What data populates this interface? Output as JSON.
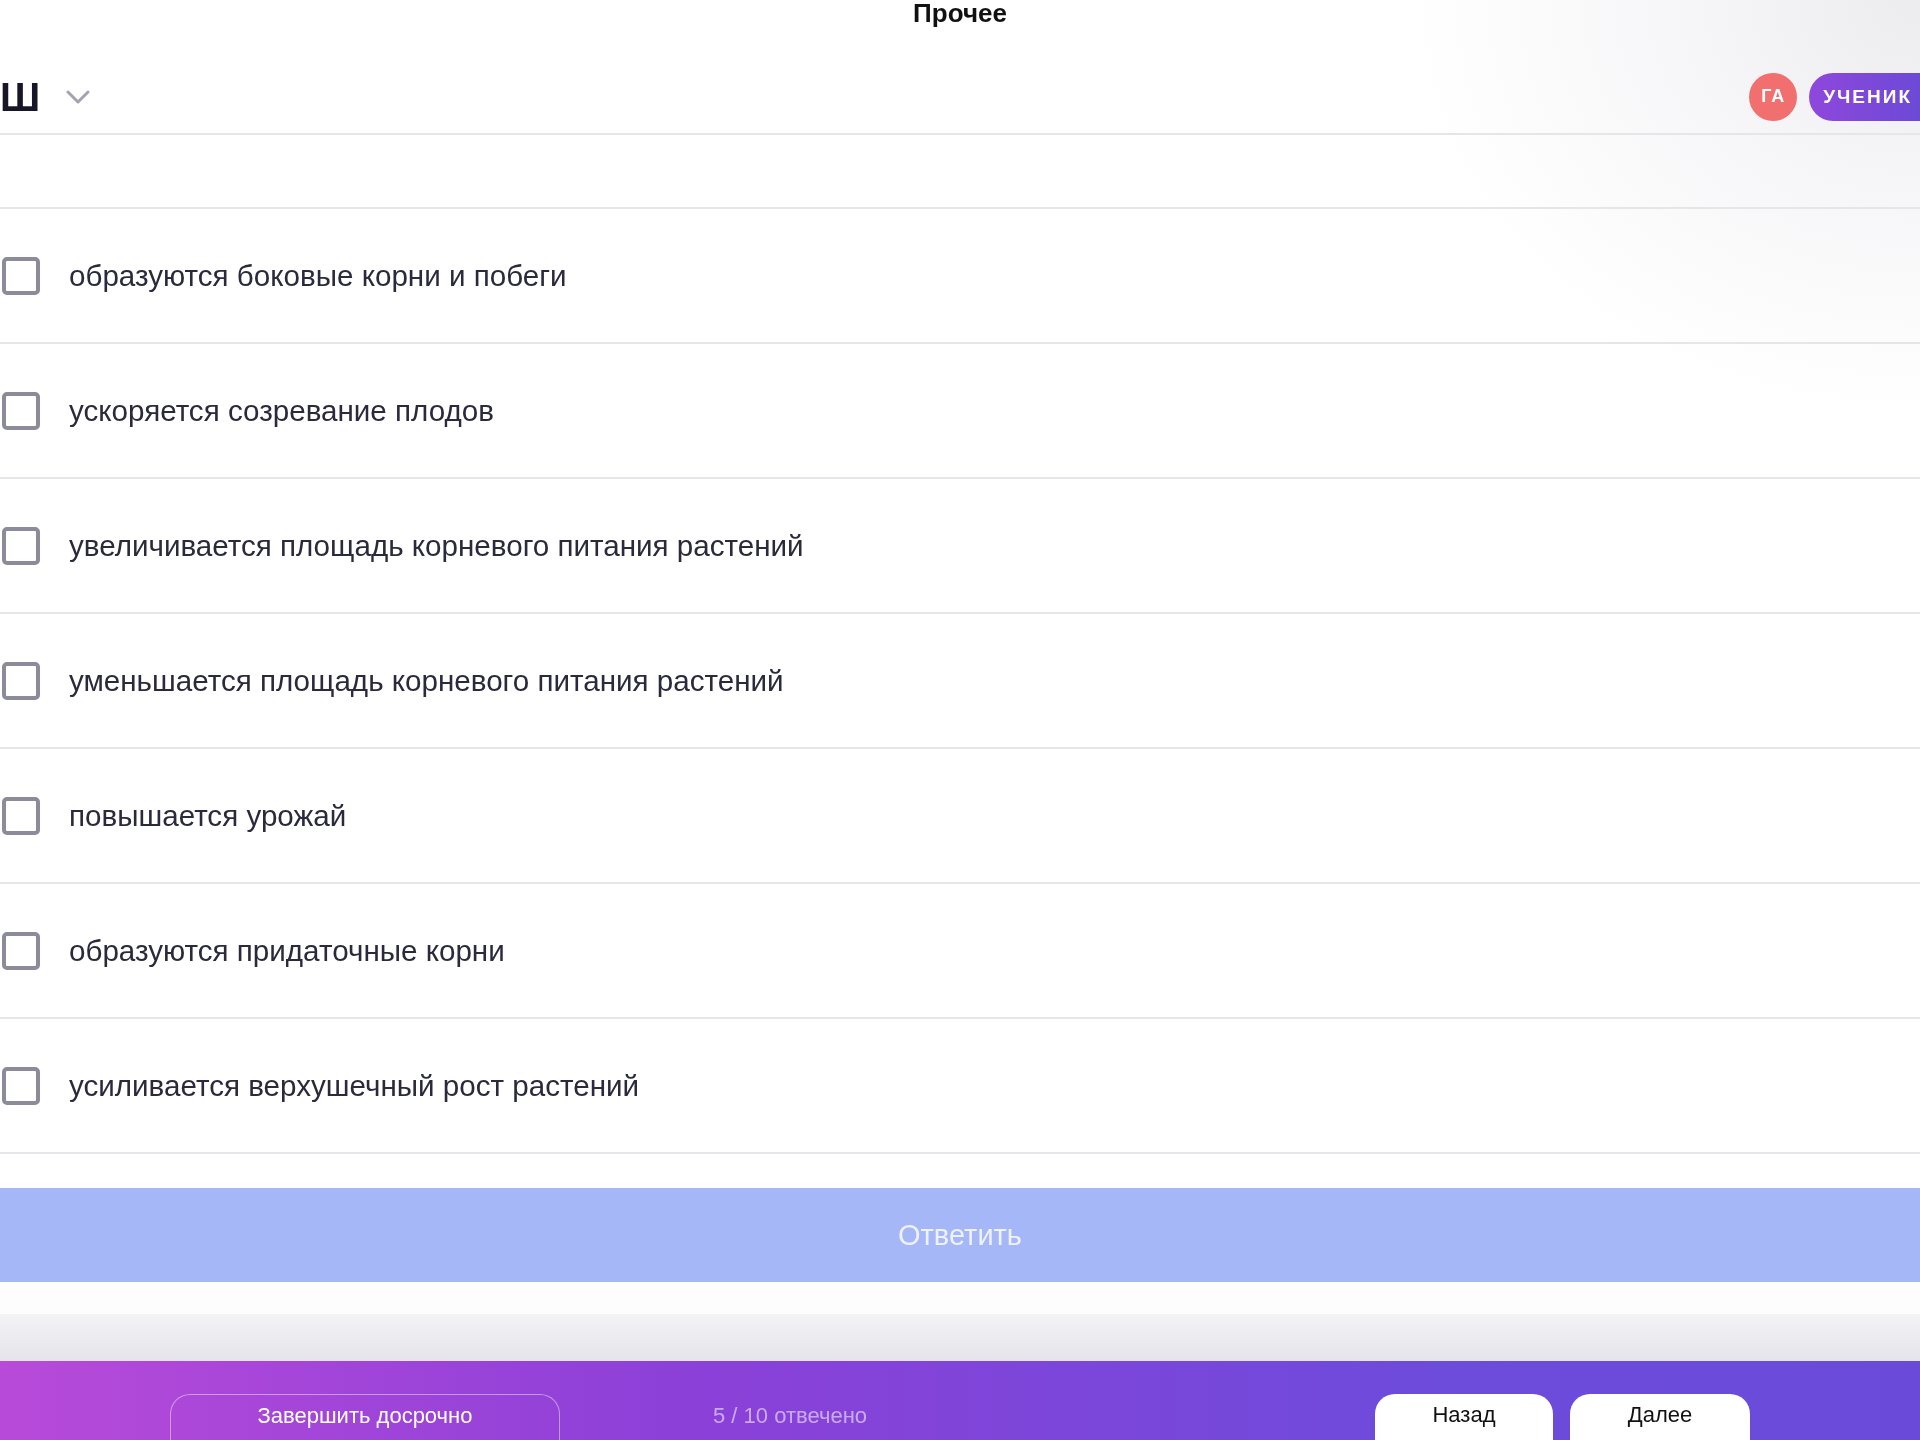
{
  "header": {
    "title": "Прочее",
    "logo_text": "Ш",
    "avatar_initials": "ГА",
    "role_badge": "УЧЕНИК"
  },
  "options": [
    {
      "label": "образуются боковые корни и побеги",
      "checked": false
    },
    {
      "label": "ускоряется созревание плодов",
      "checked": false
    },
    {
      "label": "увеличивается площадь корневого питания растений",
      "checked": false
    },
    {
      "label": "уменьшается площадь корневого питания растений",
      "checked": false
    },
    {
      "label": "повышается урожай",
      "checked": false
    },
    {
      "label": "образуются придаточные корни",
      "checked": false
    },
    {
      "label": "усиливается верхушечный рост растений",
      "checked": false
    }
  ],
  "answer_button": {
    "label": "Ответить",
    "disabled": true
  },
  "footer": {
    "finish_button": "Завершить досрочно",
    "progress": "5 / 10 отвечено",
    "back_button": "Назад",
    "next_button": "Далее"
  }
}
